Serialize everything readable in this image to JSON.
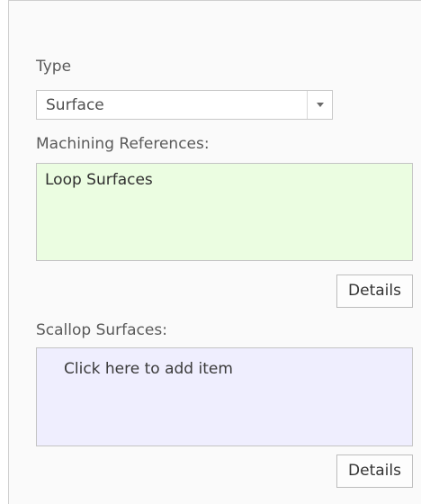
{
  "type_section": {
    "label": "Type",
    "selected_value": "Surface",
    "dropdown_icon": "chevron-down-icon"
  },
  "machining_references": {
    "label": "Machining References:",
    "items": [
      "Loop Surfaces"
    ],
    "background_color": "#ebfde1",
    "details_label": "Details"
  },
  "scallop_surfaces": {
    "label": "Scallop Surfaces:",
    "placeholder_item": "Click here to add item",
    "background_color": "#efeefe",
    "details_label": "Details"
  }
}
